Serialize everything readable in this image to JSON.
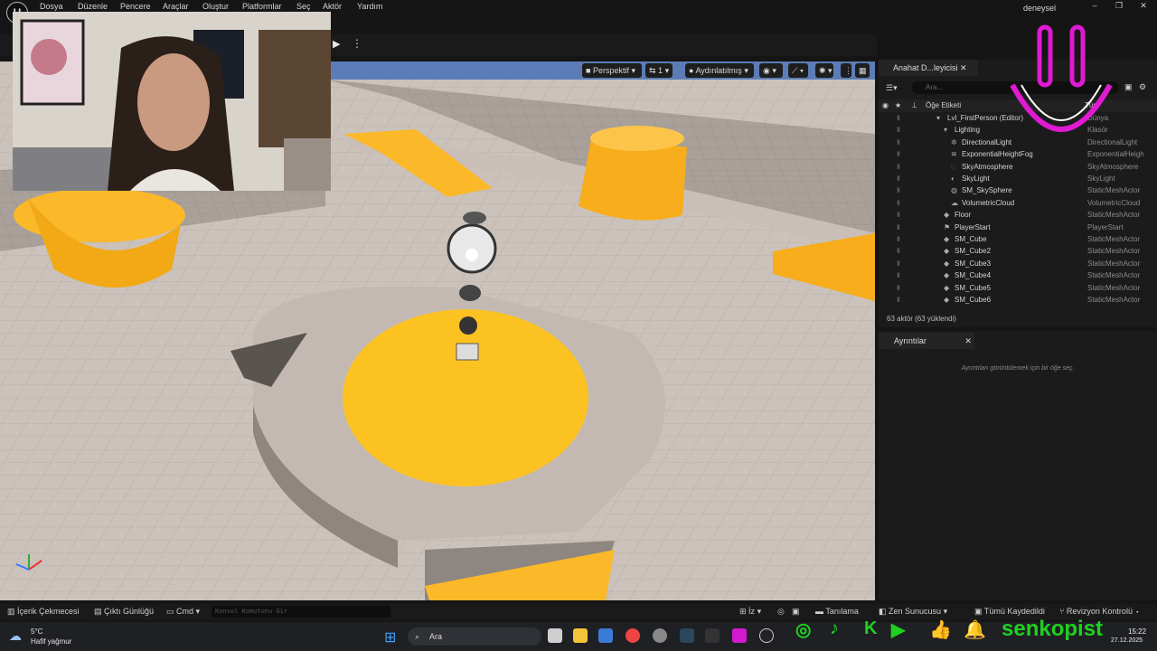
{
  "menu": {
    "items": [
      "Dosya",
      "Düzenle",
      "Pencere",
      "Araçlar",
      "Oluştur",
      "Platformlar",
      "Seç",
      "Aktör",
      "Yardım"
    ],
    "project": "deneysel"
  },
  "viewport": {
    "perspective": "Perspektif",
    "lit": "Aydınlatılmış",
    "screen_percentage": "1"
  },
  "outliner": {
    "tab": "Anahat D...leyicisi",
    "search_placeholder": "Ara...",
    "col_label": "Öğe Etiketi",
    "col_type": "Tür",
    "rows": [
      {
        "label": "Lvl_FirstPerson (Editor)",
        "type": "Dünya"
      },
      {
        "label": "Lighting",
        "type": "Klasör"
      },
      {
        "label": "DirectionalLight",
        "type": "DirectionalLight"
      },
      {
        "label": "ExponentialHeightFog",
        "type": "ExponentialHeigh"
      },
      {
        "label": "SkyAtmosphere",
        "type": "SkyAtmosphere"
      },
      {
        "label": "SkyLight",
        "type": "SkyLight"
      },
      {
        "label": "SM_SkySphere",
        "type": "StaticMeshActor"
      },
      {
        "label": "VolumetricCloud",
        "type": "VolumetricCloud"
      },
      {
        "label": "Floor",
        "type": "StaticMeshActor"
      },
      {
        "label": "PlayerStart",
        "type": "PlayerStart"
      },
      {
        "label": "SM_Cube",
        "type": "StaticMeshActor"
      },
      {
        "label": "SM_Cube2",
        "type": "StaticMeshActor"
      },
      {
        "label": "SM_Cube3",
        "type": "StaticMeshActor"
      },
      {
        "label": "SM_Cube4",
        "type": "StaticMeshActor"
      },
      {
        "label": "SM_Cube5",
        "type": "StaticMeshActor"
      },
      {
        "label": "SM_Cube6",
        "type": "StaticMeshActor"
      }
    ],
    "count": "63 aktör (63 yüklendi)"
  },
  "details": {
    "tab": "Ayrıntılar",
    "empty": "Ayrıntıları görüntülemek için bir öğe seç."
  },
  "status": {
    "content_drawer": "İçerik Çekmecesi",
    "output_log": "Çıktı Günlüğü",
    "cmd": "Cmd",
    "cmd_placeholder": "Konsol Komutunu Gir",
    "derive": "İz",
    "trace": "Tanılama",
    "zen": "Zen Sunucusu",
    "saved": "Tümü Kaydedildi",
    "revision": "Revizyon Kontrolü"
  },
  "taskbar": {
    "temp": "5°C",
    "weather": "Hafif yağmur",
    "search": "Ara",
    "time": "15:22",
    "date": "27.12.2025"
  },
  "overlay": {
    "handle": "senkopist",
    "accent": "#1fd11f",
    "smile_color": "#e01ad0"
  },
  "colors": {
    "yellow": "#fbb829",
    "floor": "#c9bfb8",
    "sky": "#5b7cb6"
  }
}
